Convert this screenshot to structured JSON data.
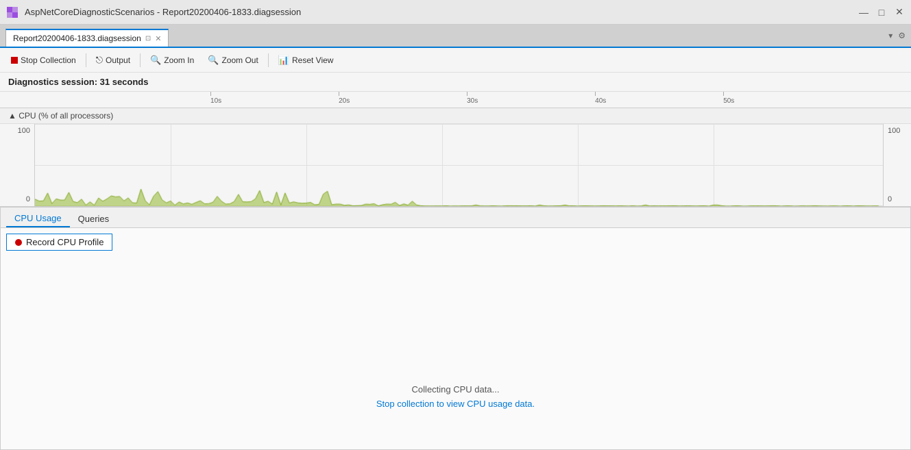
{
  "titleBar": {
    "appName": "AspNetCoreDiagnosticScenarios - Report20200406-1833.diagsession",
    "minimizeIcon": "—",
    "maximizeIcon": "□",
    "closeIcon": "✕"
  },
  "tabBar": {
    "tab": {
      "label": "Report20200406-1833.diagsession",
      "pinIcon": "⊡",
      "closeIcon": "✕"
    },
    "dropdownIcon": "▾",
    "settingsIcon": "⚙"
  },
  "toolbar": {
    "stopCollection": "Stop Collection",
    "output": "Output",
    "zoomIn": "Zoom In",
    "zoomOut": "Zoom Out",
    "resetView": "Reset View"
  },
  "diagnosticsHeader": "Diagnostics session: 31 seconds",
  "timeline": {
    "ticks": [
      "10s",
      "20s",
      "30s",
      "40s",
      "50s"
    ]
  },
  "chart": {
    "title": "▲ CPU (% of all processors)",
    "yAxisMax": "100",
    "yAxisMin": "0",
    "yAxisMaxRight": "100",
    "yAxisMinRight": "0"
  },
  "bottomPanel": {
    "tabs": [
      "CPU Usage",
      "Queries"
    ],
    "activeTab": "CPU Usage",
    "recordBtn": "Record CPU Profile",
    "collectingMsg": "Collecting CPU data...",
    "stopCollectionLink": "Stop collection to view CPU usage data."
  }
}
